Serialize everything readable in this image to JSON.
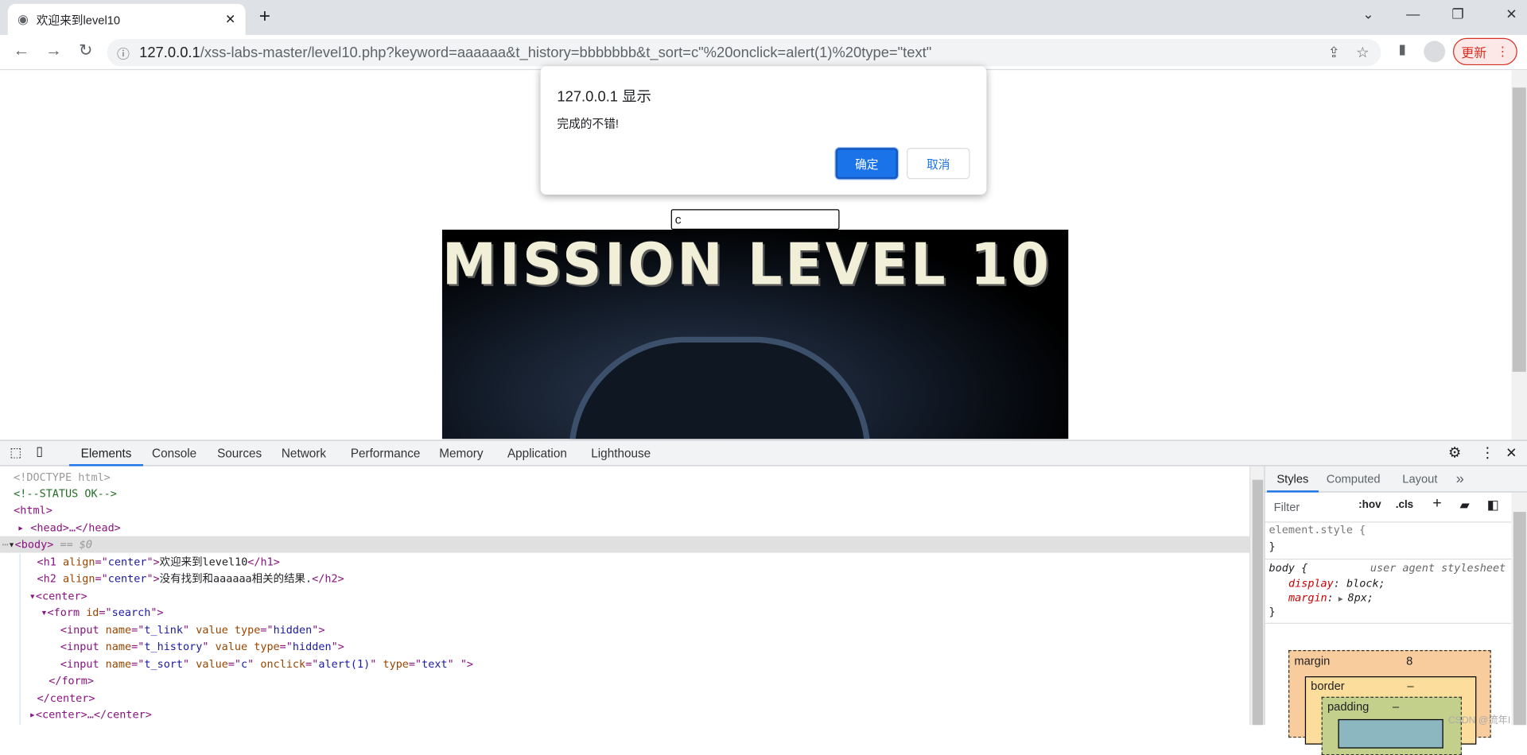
{
  "browser": {
    "tab_title": "欢迎来到level10",
    "url_host": "127.0.0.1",
    "url_rest": "/xss-labs-master/level10.php?keyword=aaaaaa&t_history=bbbbbbb&t_sort=c\"%20onclick=alert(1)%20type=\"text\"",
    "update_label": "更新"
  },
  "dialog": {
    "title": "127.0.0.1 显示",
    "message": "完成的不错!",
    "ok_label": "确定",
    "cancel_label": "取消"
  },
  "page": {
    "input_value": "c",
    "image_text": "MISSION LEVEL 10"
  },
  "devtools": {
    "tabs": [
      "Elements",
      "Console",
      "Sources",
      "Network",
      "Performance",
      "Memory",
      "Application",
      "Lighthouse"
    ],
    "active_tab": "Elements",
    "dom": {
      "doctype": "<!DOCTYPE html>",
      "comment": "<!--STATUS OK-->",
      "html": "<html>",
      "head": "<head>…</head>",
      "body": "<body>",
      "body_marker": " == $0",
      "h1_text": "欢迎来到level10",
      "h2_text": "没有找到和aaaaaa相关的结果.",
      "t_link": "t_link",
      "t_history": "t_history",
      "t_sort": "t_sort",
      "t_sort_value": "c",
      "onclick": "alert(1)",
      "type_text": "text"
    },
    "styles": {
      "tabs": [
        "Styles",
        "Computed",
        "Layout",
        "»"
      ],
      "filter_placeholder": "Filter",
      "hov": ":hov",
      "cls": ".cls",
      "element_style": "element.style {",
      "close_brace": "}",
      "body_selector": "body {",
      "ua": "user agent stylesheet",
      "prop1": "display",
      "val1": "block;",
      "prop2": "margin",
      "val2": "8px;",
      "box_margin": "margin",
      "box_margin_val": "8",
      "box_border": "border",
      "box_border_val": "–",
      "box_padding": "padding",
      "box_padding_val": "–"
    },
    "watermark": "CSDN @流年I"
  }
}
